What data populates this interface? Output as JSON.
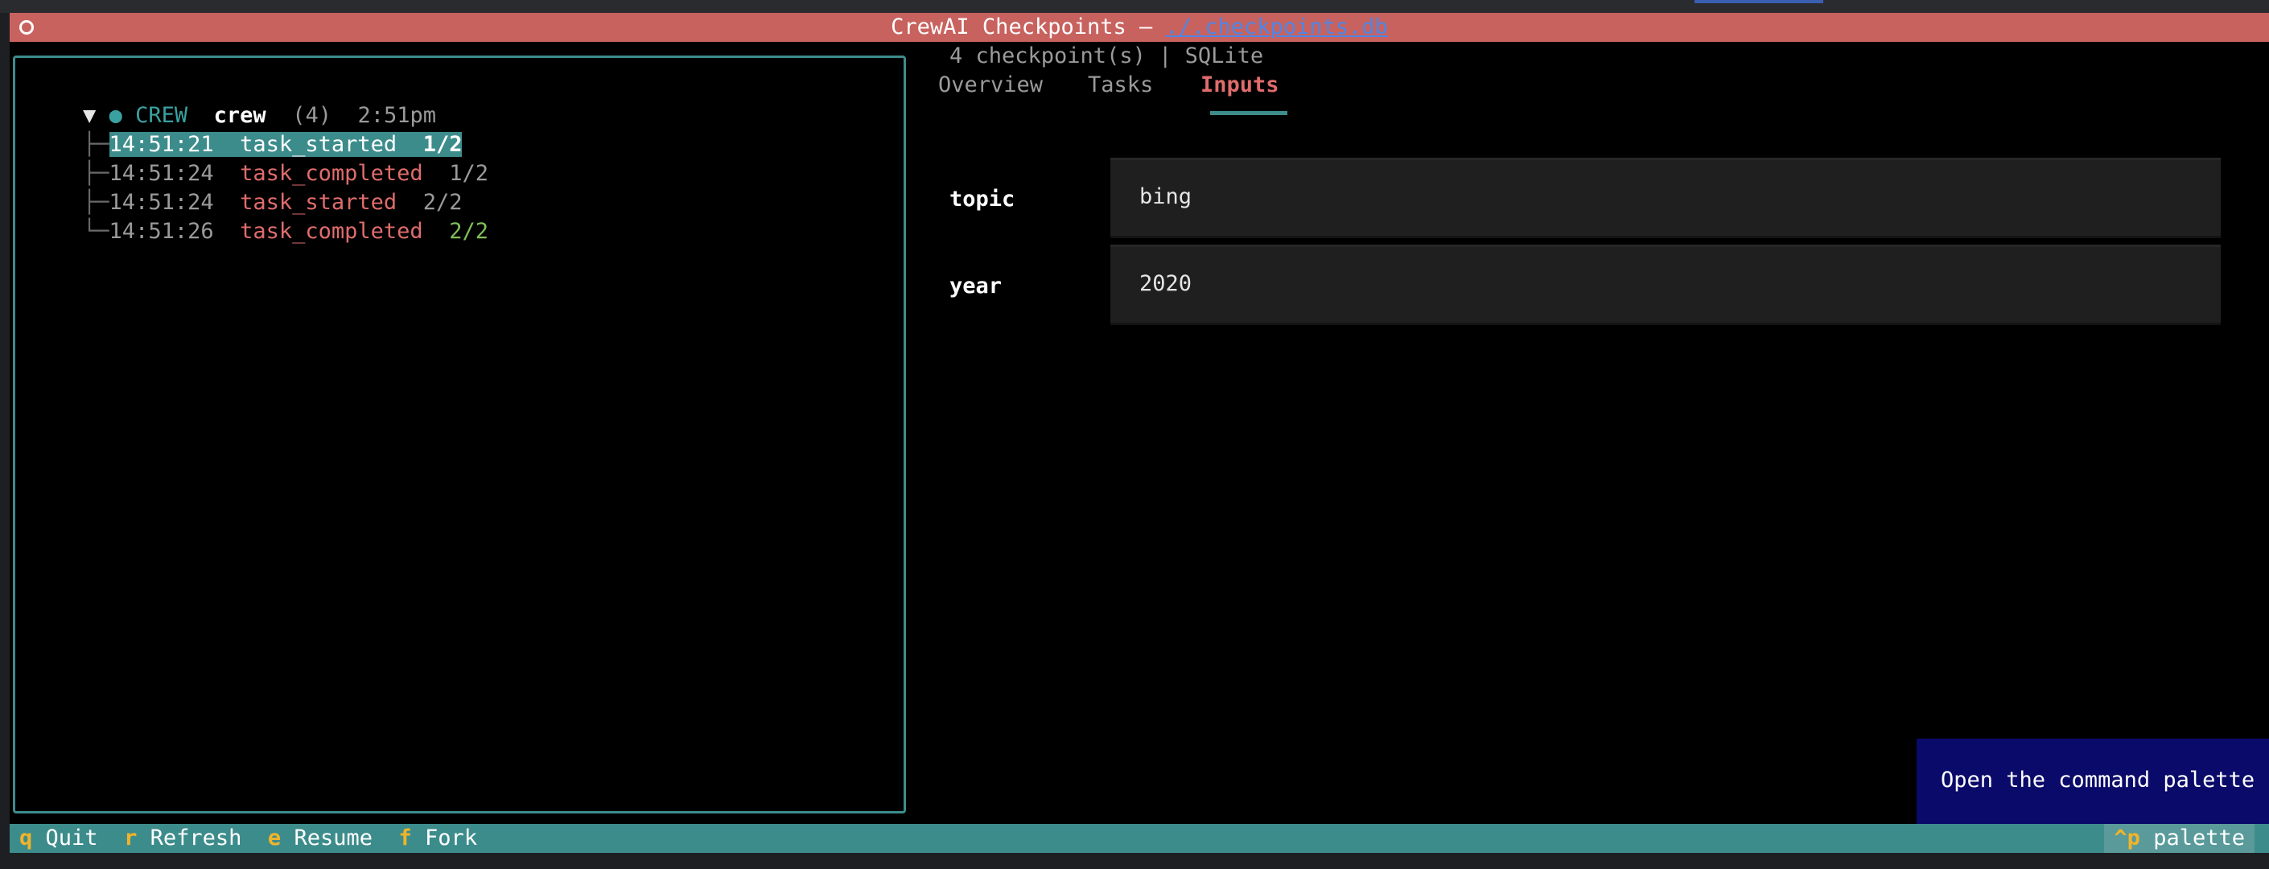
{
  "window": {
    "title_prefix": "CrewAI Checkpoints — ",
    "title_path": "./.checkpoints.db"
  },
  "tree": {
    "root": {
      "arrow": "▼",
      "dot": "●",
      "kind": "CREW",
      "name": "crew",
      "count": "(4)",
      "time": "2:51pm"
    },
    "items": [
      {
        "branch": "├─",
        "time": "14:51:21",
        "event": "task_started",
        "progress": "1/2",
        "selected": true
      },
      {
        "branch": "├─",
        "time": "14:51:24",
        "event": "task_completed",
        "progress": "1/2",
        "selected": false
      },
      {
        "branch": "├─",
        "time": "14:51:24",
        "event": "task_started",
        "progress": "2/2",
        "selected": false
      },
      {
        "branch": "└─",
        "time": "14:51:26",
        "event": "task_completed",
        "progress": "2/2",
        "selected": false
      }
    ]
  },
  "detail": {
    "summary": "4 checkpoint(s) | SQLite",
    "tabs": [
      {
        "label": "Overview",
        "active": false
      },
      {
        "label": "Tasks",
        "active": false
      },
      {
        "label": "Inputs",
        "active": true
      }
    ],
    "inputs": [
      {
        "key": "topic",
        "value": "bing"
      },
      {
        "key": "year",
        "value": "2020"
      }
    ]
  },
  "tooltip": {
    "text": "Open the command palette"
  },
  "footer": {
    "bindings": [
      {
        "key": "q",
        "label": "Quit"
      },
      {
        "key": "r",
        "label": "Refresh"
      },
      {
        "key": "e",
        "label": "Resume"
      },
      {
        "key": "f",
        "label": "Fork"
      }
    ],
    "palette_key": "^p",
    "palette_label": "palette"
  },
  "colors": {
    "accent": "#3d8c8c",
    "title_bar": "#c8625f",
    "event_red": "#e06c6c",
    "progress_green": "#7fbf5a",
    "tooltip_bg": "#0a0a6a",
    "key_yellow": "#f0b429"
  }
}
